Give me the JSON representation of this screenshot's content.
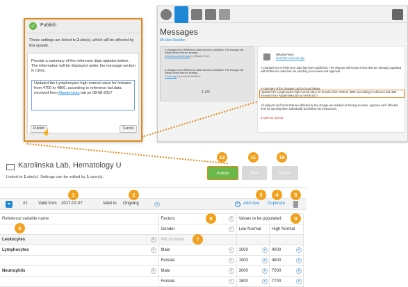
{
  "messages_panel": {
    "title": "Messages",
    "filter": "All sites  Sweden",
    "list": [
      {
        "text": "A changed set of Reference data has been published. The changes will impact forms that are already...",
        "meta": "less than a minute ago",
        "by": "by Mikaela Pavel"
      },
      {
        "text": "A changed set of Reference data has been published. The changes will impact forms that are already...",
        "meta": "2 days ago",
        "by": "by Andreas Medlund"
      }
    ],
    "pager": "1-2/2",
    "detail": {
      "author": "Mikaela Pavel",
      "time": "less than a minute ago",
      "para1": "A changed set of Reference data has been published. The changes will impact forms that are already populated with Reference data that are pending your review and approval.",
      "para2_label": "A summary of the changes can be found below:",
      "para2_text": "Updated the Lymphocytes high normal value for females from 4700 to 4800, according to reference lad data received from Akademiska lab on 08-08-2017.",
      "para3": "All subjects and forms that are affected by the change are marked as having an issue. Approve each affected form by opening them individually and follow the instructions.",
      "mark_read": "Mark as unread"
    }
  },
  "publish_dialog": {
    "title": "Publish",
    "info_pre": "These settings are linked to ",
    "info_count": "1",
    "info_post": " site(s), which will be affected by this update.",
    "summary_label": "Provide a summary of the reference data updates below. The information will be displayed under the message section in Clinic.",
    "summary_text_pre": "Updated the Lymphocytes high normal value for females from 4700 to 4800, according to reference lad data received from ",
    "summary_text_link": "Akademiska",
    "summary_text_post": " lab on 08-08-2017",
    "publish_label": "Publish",
    "cancel_label": "Cancel"
  },
  "main": {
    "title": "Karolinska Lab, Hematology U",
    "linked_pre": "Linked to ",
    "linked_sites": "1",
    "linked_mid": " site(s). Settings can be edited by ",
    "linked_users": "1",
    "linked_post": " user(s).",
    "publish_label": "Publish",
    "save_label": "Save",
    "cancel_label": "Cancel",
    "version_num": "#1",
    "valid_from_label": "Valid from",
    "valid_from_value": "2017-07-07",
    "valid_to_label": "Valid to",
    "valid_to_value": "Ongoing",
    "add_new": "Add new",
    "duplicate": "Duplicate"
  },
  "table": {
    "headers": {
      "ref_var": "Reference variable name",
      "factors": "Factors",
      "gender": "Gender",
      "values": "Values to be populated",
      "low": "Low Normal",
      "high": "High Normal"
    },
    "rows": [
      {
        "name": "Leukocytes",
        "factor": "Not included",
        "low": "",
        "high": ""
      },
      {
        "name": "Lymphocytes",
        "factor": "Male",
        "low": "1000",
        "high": "4000"
      },
      {
        "name": "",
        "factor": "Female",
        "low": "1000",
        "high": "4800"
      },
      {
        "name": "Neutrophils",
        "factor": "Male",
        "low": "3000",
        "high": "7000"
      },
      {
        "name": "",
        "factor": "Female",
        "low": "1800",
        "high": "7700"
      }
    ]
  },
  "badges": [
    "1",
    "2",
    "3",
    "4",
    "5",
    "6",
    "7",
    "8",
    "9",
    "10",
    "11",
    "12"
  ],
  "colors": {
    "accent": "#e08a1c",
    "badge": "#f2a11f",
    "primary": "#1e88d6",
    "publish": "#6ab84a"
  }
}
